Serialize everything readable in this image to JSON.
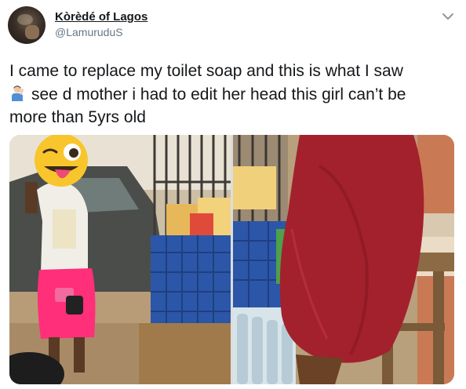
{
  "user": {
    "display_name": "Kòrèdé of Lagos",
    "handle": "@LamuruduS"
  },
  "tweet": {
    "line1": "I came to replace my toilet soap and this is what I saw",
    "line2_emoji": "facepalm-icon",
    "line2": "see d mother i had to edit her head this girl can’t be",
    "line3": "more than 5yrs old"
  },
  "icons": {
    "menu": "chevron-down-icon",
    "face_cover": "winking-tongue-emoji"
  },
  "colors": {
    "text": "#14171a",
    "secondary": "#657786",
    "dress_red": "#a3212c",
    "skirt_pink": "#ff2f7a",
    "crate_blue": "#2c57a8"
  }
}
